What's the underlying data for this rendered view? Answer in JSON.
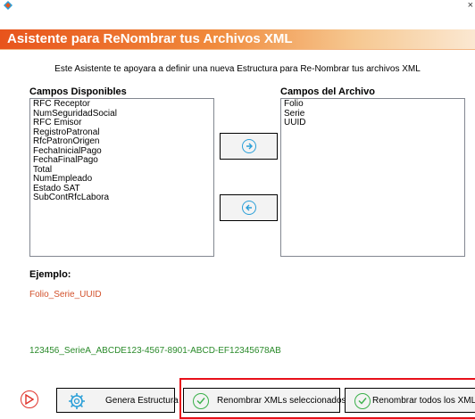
{
  "window": {
    "close_glyph": "×"
  },
  "header": {
    "title": "Asistente para ReNombrar tus Archivos XML"
  },
  "description": "Este Asistente te apoyara a definir una nueva Estructura para Re-Nombrar tus archivos XML",
  "available_fields": {
    "label": "Campos Disponibles",
    "items": [
      "RFC Receptor",
      "NumSeguridadSocial",
      "RFC Emisor",
      "RegistroPatronal",
      "RfcPatronOrigen",
      "FechaInicialPago",
      "FechaFinalPago",
      "Total",
      "NumEmpleado",
      "Estado SAT",
      "SubContRfcLabora"
    ]
  },
  "file_fields": {
    "label": "Campos del Archivo",
    "items": [
      "Folio",
      "Serie",
      "UUID"
    ]
  },
  "example": {
    "label": "Ejemplo:",
    "pattern": "Folio_Serie_UUID",
    "sample": "123456_SerieA_ABCDE123-4567-8901-ABCD-EF12345678AB"
  },
  "buttons": {
    "generate": "Genera Estructura",
    "rename_selected": "Renombrar XMLs seleccionados",
    "rename_all": "Renombrar todos los XMLs"
  },
  "icons": {
    "app": "app-logo-icon",
    "move_right": "arrow-right-circle-icon",
    "move_left": "arrow-left-circle-icon",
    "stop": "play-stop-icon",
    "gear": "gear-icon",
    "check": "check-circle-icon"
  },
  "colors": {
    "header_start": "#e8541c",
    "header_end": "#fbe8d2",
    "pattern_text": "#d2502a",
    "sample_text": "#2a8a2a",
    "highlight": "#e8101a",
    "accent_blue": "#2a9fd8",
    "check_green": "#3ab04a"
  }
}
